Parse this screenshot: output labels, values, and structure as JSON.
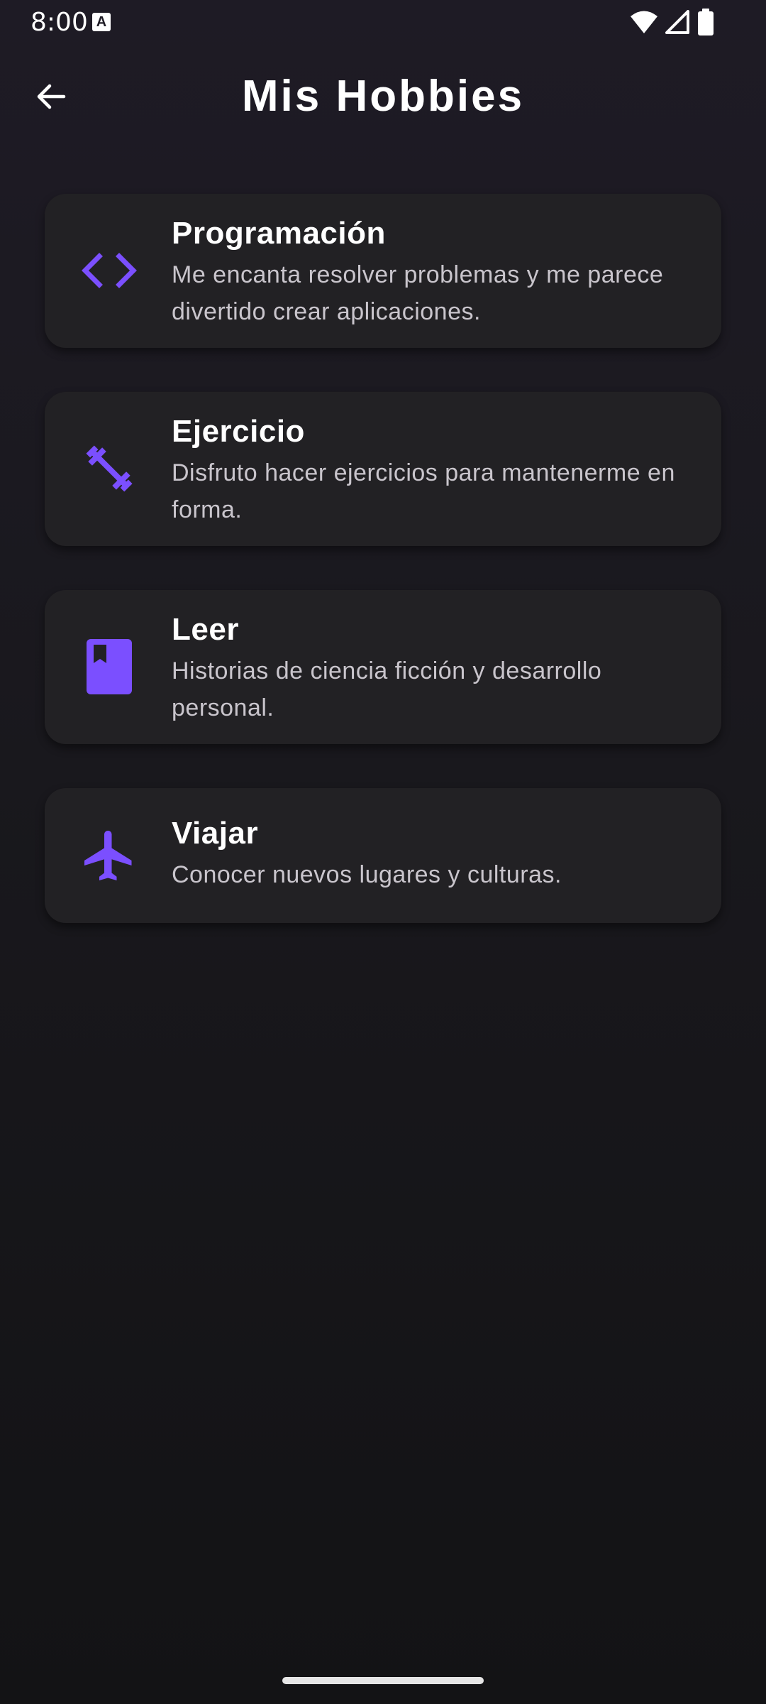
{
  "status_bar": {
    "time": "8:00",
    "notification_badge": "A"
  },
  "app_bar": {
    "title": "Mis Hobbies",
    "back_icon": "arrow-back-icon"
  },
  "accent_color": "#7b4fff",
  "hobbies": [
    {
      "icon": "code-icon",
      "title": "Programación",
      "description": "Me encanta resolver problemas y me parece divertido crear aplicaciones."
    },
    {
      "icon": "fitness-icon",
      "title": "Ejercicio",
      "description": "Disfruto hacer ejercicios para mantenerme en forma."
    },
    {
      "icon": "book-icon",
      "title": "Leer",
      "description": "Historias de ciencia ficción y desarrollo personal."
    },
    {
      "icon": "airplane-icon",
      "title": "Viajar",
      "description": "Conocer nuevos lugares y culturas."
    }
  ]
}
